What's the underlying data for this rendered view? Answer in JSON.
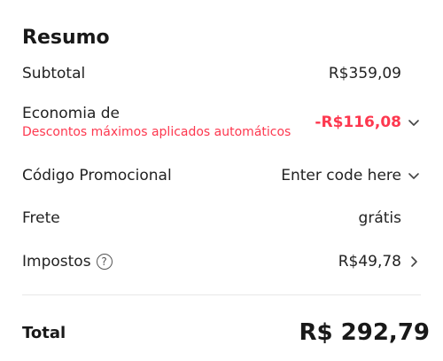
{
  "summary": {
    "title": "Resumo",
    "subtotal_label": "Subtotal",
    "subtotal_value": "R$359,09",
    "savings_label": "Economia de",
    "savings_note": "Descontos máximos aplicados automáticos",
    "savings_value": "-R$116,08",
    "promo_label": "Código Promocional",
    "promo_placeholder": "Enter code here",
    "shipping_label": "Frete",
    "shipping_value": "grátis",
    "taxes_label": "Impostos",
    "taxes_help": "?",
    "taxes_value": "R$49,78",
    "total_label": "Total",
    "total_value": "R$ 292,79"
  },
  "colors": {
    "accent_red": "#fd384f",
    "text": "#191919"
  },
  "icons": [
    "chevron-down-icon",
    "help-circle-icon",
    "chevron-right-icon"
  ]
}
